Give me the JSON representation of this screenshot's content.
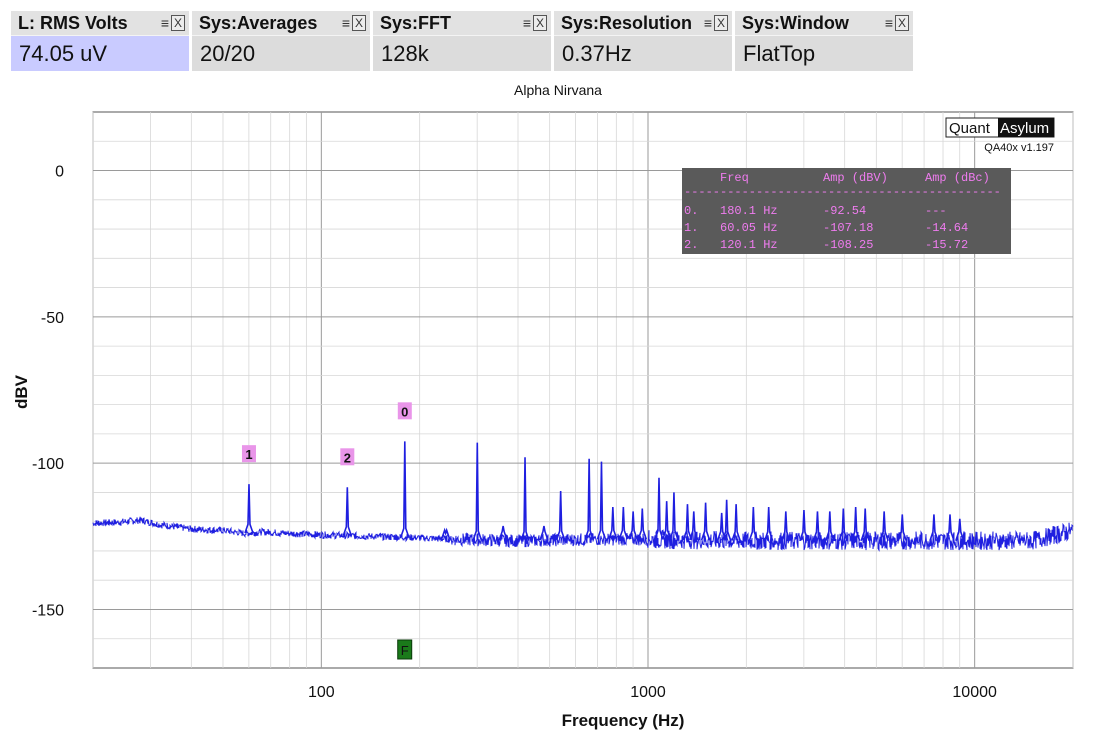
{
  "meters": [
    {
      "title": "L: RMS Volts",
      "value": "74.05 uV",
      "highlight": true
    },
    {
      "title": "Sys:Averages",
      "value": "20/20",
      "highlight": false
    },
    {
      "title": "Sys:FFT",
      "value": "128k",
      "highlight": false
    },
    {
      "title": "Sys:Resolution",
      "value": "0.37Hz",
      "highlight": false
    },
    {
      "title": "Sys:Window",
      "value": "FlatTop",
      "highlight": false
    }
  ],
  "meter_icons": {
    "menu": "≡",
    "close": "X"
  },
  "logo": {
    "left": "Quant",
    "right": "Asylum",
    "version": "QA40x v1.197"
  },
  "colors": {
    "trace": "#1f1fe0",
    "marker_bg": "#e995e9",
    "readout_bg": "#5a5a5a",
    "readout_text": "#ef7cef",
    "freq_marker_bg": "#1a7a1a",
    "highlight_meter": "#c9cbff"
  },
  "chart_data": {
    "type": "line",
    "title": "Alpha Nirvana",
    "xlabel": "Frequency (Hz)",
    "ylabel": "dBV",
    "xscale": "log",
    "xlim": [
      20,
      20000
    ],
    "ylim": [
      -170,
      20
    ],
    "xticks": [
      100,
      1000,
      10000
    ],
    "xtick_labels": [
      "100",
      "1000",
      "10000"
    ],
    "yticks": [
      0,
      -50,
      -100,
      -150
    ],
    "ytick_labels": [
      "0",
      "-50",
      "-100",
      "-150"
    ],
    "grid": true,
    "series": [
      {
        "noise_floor": [
          [
            20,
            -120.5
          ],
          [
            24,
            -120.2
          ],
          [
            28,
            -119.5
          ],
          [
            32,
            -121
          ],
          [
            40,
            -122.5
          ],
          [
            50,
            -123
          ],
          [
            58,
            -124
          ],
          [
            66,
            -123.5
          ],
          [
            80,
            -124
          ],
          [
            100,
            -124.5
          ],
          [
            140,
            -125
          ],
          [
            180,
            -125.3
          ],
          [
            250,
            -126
          ],
          [
            400,
            -126.5
          ],
          [
            700,
            -126
          ],
          [
            1000,
            -126
          ],
          [
            2000,
            -126.5
          ],
          [
            5000,
            -126.5
          ],
          [
            10000,
            -126.5
          ],
          [
            15000,
            -126.5
          ],
          [
            17000,
            -125
          ],
          [
            20000,
            -123
          ]
        ],
        "peaks": [
          [
            60.05,
            -107.18
          ],
          [
            120.1,
            -108.25
          ],
          [
            180.1,
            -92.54
          ],
          [
            240.2,
            -124
          ],
          [
            300.2,
            -93
          ],
          [
            360.2,
            -121.5
          ],
          [
            420.3,
            -98
          ],
          [
            480.3,
            -121.5
          ],
          [
            540.3,
            -109.5
          ],
          [
            660.4,
            -98.5
          ],
          [
            720.4,
            -99.5
          ],
          [
            780.5,
            -115
          ],
          [
            840.5,
            -115
          ],
          [
            900.5,
            -116.5
          ],
          [
            960.6,
            -115.5
          ],
          [
            1080.6,
            -105
          ],
          [
            1140.7,
            -113
          ],
          [
            1200.7,
            -110
          ],
          [
            1320.8,
            -114
          ],
          [
            1380.8,
            -116.5
          ],
          [
            1500.9,
            -113.5
          ],
          [
            1681,
            -117
          ],
          [
            1741,
            -112.5
          ],
          [
            1861.1,
            -114
          ],
          [
            2101.3,
            -115
          ],
          [
            2341.4,
            -115
          ],
          [
            2641.6,
            -116.5
          ],
          [
            3001.8,
            -116
          ],
          [
            3302,
            -116.5
          ],
          [
            3602.2,
            -116.5
          ],
          [
            3962.4,
            -115.5
          ],
          [
            4322.6,
            -115
          ],
          [
            4622.8,
            -115.5
          ],
          [
            5283.2,
            -116.5
          ],
          [
            6003.6,
            -117.5
          ],
          [
            7504.5,
            -117.5
          ],
          [
            8404.5,
            -117.5
          ],
          [
            9004.5,
            -119
          ]
        ]
      }
    ],
    "markers": [
      {
        "label": "0",
        "freq": 180.1,
        "amp": -92.54,
        "dbc": null
      },
      {
        "label": "1",
        "freq": 60.05,
        "amp": -107.18,
        "dbc": -14.64
      },
      {
        "label": "2",
        "freq": 120.1,
        "amp": -108.25,
        "dbc": -15.72
      }
    ],
    "freq_marker": {
      "label": "F",
      "freq": 180
    },
    "readout": {
      "headers": [
        "Freq",
        "Amp (dBV)",
        "Amp (dBc)"
      ],
      "rows": [
        [
          "0.",
          "180.1 Hz",
          "-92.54",
          "---"
        ],
        [
          "1.",
          "60.05 Hz",
          "-107.18",
          "-14.64"
        ],
        [
          "2.",
          "120.1 Hz",
          "-108.25",
          "-15.72"
        ]
      ]
    }
  }
}
